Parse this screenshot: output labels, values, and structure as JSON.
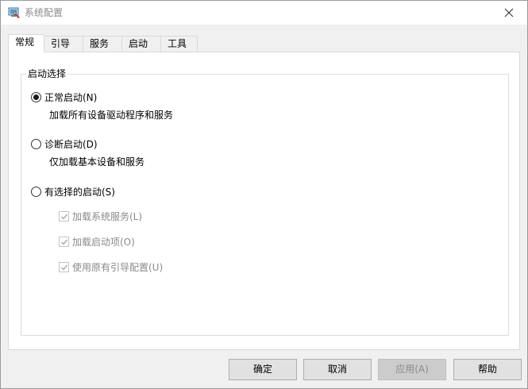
{
  "window": {
    "title": "系统配置",
    "close_icon": "close-icon",
    "app_icon": "msconfig-icon"
  },
  "tabs": [
    {
      "label": "常规",
      "active": true
    },
    {
      "label": "引导",
      "active": false
    },
    {
      "label": "服务",
      "active": false
    },
    {
      "label": "启动",
      "active": false
    },
    {
      "label": "工具",
      "active": false
    }
  ],
  "startup_selection": {
    "group_label": "启动选择",
    "options": [
      {
        "label": "正常启动(N)",
        "description": "加载所有设备驱动程序和服务",
        "selected": true
      },
      {
        "label": "诊断启动(D)",
        "description": "仅加载基本设备和服务",
        "selected": false
      },
      {
        "label": "有选择的启动(S)",
        "selected": false
      }
    ],
    "selective_items": [
      {
        "label": "加载系统服务(L)",
        "checked": true,
        "enabled": false
      },
      {
        "label": "加载启动项(O)",
        "checked": true,
        "enabled": false
      },
      {
        "label": "使用原有引导配置(U)",
        "checked": true,
        "enabled": false
      }
    ]
  },
  "buttons": {
    "ok": "确定",
    "cancel": "取消",
    "apply": "应用(A)",
    "help": "帮助"
  },
  "colors": {
    "window_bg": "#f0f0f0",
    "panel_bg": "#ffffff",
    "disabled_text": "#8a8a8a"
  }
}
